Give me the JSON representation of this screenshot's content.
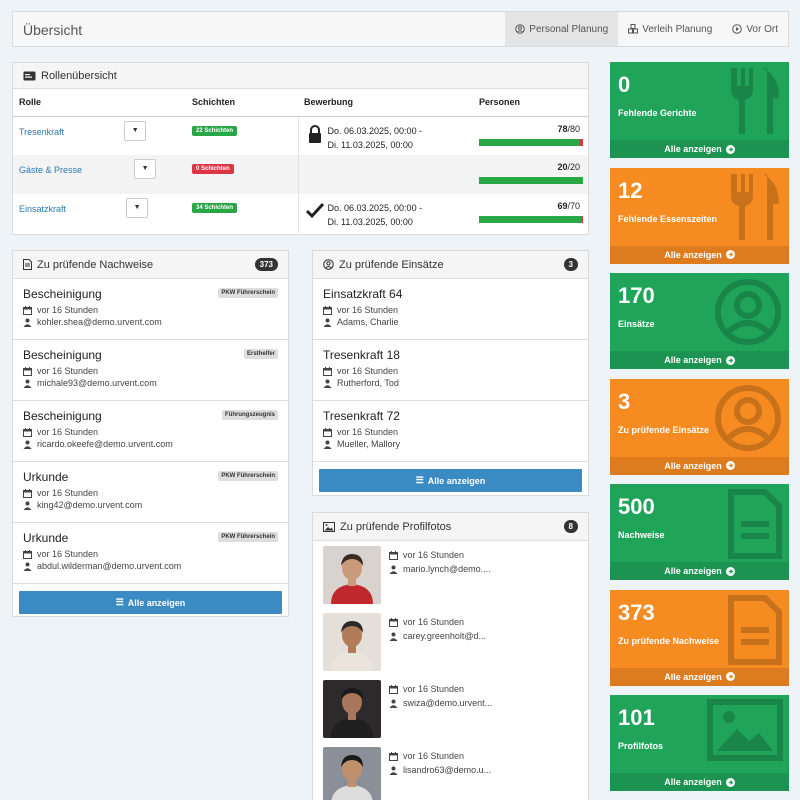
{
  "header": {
    "title": "Übersicht",
    "tabs": [
      {
        "label": "Personal Planung",
        "icon": "user-circle-icon"
      },
      {
        "label": "Verleih Planung",
        "icon": "cubes-icon"
      },
      {
        "label": "Vor Ort",
        "icon": "play-circle-icon"
      }
    ]
  },
  "roles": {
    "title": "Rollenübersicht",
    "columns": [
      "Rolle",
      "Schichten",
      "Bewerbung",
      "Personen"
    ],
    "rows": [
      {
        "role": "Tresenkraft",
        "shifts": "22 Schichten",
        "shift_color": "green",
        "status_icon": "lock-icon",
        "bew_line1": "Do. 06.03.2025, 00:00 -",
        "bew_line2": "Di. 11.03.2025, 00:00",
        "count": "78",
        "total": "/80",
        "fill": 0.975
      },
      {
        "role": "Gäste & Presse",
        "shifts": "0 Schichten",
        "shift_color": "red",
        "status_icon": "",
        "bew_line1": "",
        "bew_line2": "",
        "count": "20",
        "total": "/20",
        "fill": 1.0
      },
      {
        "role": "Einsatzkraft",
        "shifts": "34 Schichten",
        "shift_color": "green",
        "status_icon": "check-icon",
        "bew_line1": "Do. 06.03.2025, 00:00 -",
        "bew_line2": "Di. 11.03.2025, 00:00",
        "count": "69",
        "total": "/70",
        "fill": 0.986
      }
    ]
  },
  "nachweise": {
    "title": "Zu prüfende Nachweise",
    "count": "373",
    "items": [
      {
        "title": "Bescheinigung",
        "tag": "PKW Führerschein",
        "time": "vor 16 Stunden",
        "user": "kohler.shea@demo.urvent.com"
      },
      {
        "title": "Bescheinigung",
        "tag": "Ersthelfer",
        "time": "vor 16 Stunden",
        "user": "michale93@demo.urvent.com"
      },
      {
        "title": "Bescheinigung",
        "tag": "Führungszeugnis",
        "time": "vor 16 Stunden",
        "user": "ricardo.okeefe@demo.urvent.com"
      },
      {
        "title": "Urkunde",
        "tag": "PKW Führerschein",
        "time": "vor 16 Stunden",
        "user": "king42@demo.urvent.com"
      },
      {
        "title": "Urkunde",
        "tag": "PKW Führerschein",
        "time": "vor 16 Stunden",
        "user": "abdul.wilderman@demo.urvent.com"
      }
    ],
    "button": "Alle anzeigen"
  },
  "einsaetze": {
    "title": "Zu prüfende Einsätze",
    "count": "3",
    "items": [
      {
        "title": "Einsatzkraft 64",
        "time": "vor 16 Stunden",
        "user": "Adams, Charlie"
      },
      {
        "title": "Tresenkraft 18",
        "time": "vor 16 Stunden",
        "user": "Rutherford, Tod"
      },
      {
        "title": "Tresenkraft 72",
        "time": "vor 16 Stunden",
        "user": "Mueller, Mallory"
      }
    ],
    "button": "Alle anzeigen"
  },
  "profilfotos": {
    "title": "Zu prüfende Profilfotos",
    "count": "8",
    "items": [
      {
        "time": "vor 16 Stunden",
        "user": "mario.lynch@demo....",
        "photo_bg": "#d9d3cf",
        "shirt": "#c0282d",
        "skin": "#c99a7c",
        "hair": "#3a2a22"
      },
      {
        "time": "vor 16 Stunden",
        "user": "carey.greenholt@d...",
        "photo_bg": "#e4dfd8",
        "shirt": "#e9e4dc",
        "skin": "#b07b56",
        "hair": "#2a2a2a"
      },
      {
        "time": "vor 16 Stunden",
        "user": "swiza@demo.urvent...",
        "photo_bg": "#2c2a2a",
        "shirt": "#1f1f1f",
        "skin": "#a8765a",
        "hair": "#1a1a1a"
      },
      {
        "time": "vor 16 Stunden",
        "user": "lisandro63@demo.u...",
        "photo_bg": "#8b8f98",
        "shirt": "#ddd",
        "skin": "#c08f6c",
        "hair": "#1b1b1b"
      }
    ]
  },
  "cards": [
    {
      "value": "0",
      "label": "Fehlende Gerichte",
      "color": "#20a45a",
      "icon": "utensils-icon",
      "link": "Alle anzeigen"
    },
    {
      "value": "12",
      "label": "Fehlende Essenszeiten",
      "color": "#f68b22",
      "icon": "utensils-icon",
      "link": "Alle anzeigen"
    },
    {
      "value": "170",
      "label": "Einsätze",
      "color": "#20a45a",
      "icon": "user-circle-icon",
      "link": "Alle anzeigen"
    },
    {
      "value": "3",
      "label": "Zu prüfende Einsätze",
      "color": "#f68b22",
      "icon": "user-circle-icon",
      "link": "Alle anzeigen"
    },
    {
      "value": "500",
      "label": "Nachweise",
      "color": "#20a45a",
      "icon": "file-text-icon",
      "link": "Alle anzeigen"
    },
    {
      "value": "373",
      "label": "Zu prüfende Nachweise",
      "color": "#f68b22",
      "icon": "file-text-icon",
      "link": "Alle anzeigen"
    },
    {
      "value": "101",
      "label": "Profilfotos",
      "color": "#20a45a",
      "icon": "image-icon",
      "link": "Alle anzeigen"
    }
  ]
}
